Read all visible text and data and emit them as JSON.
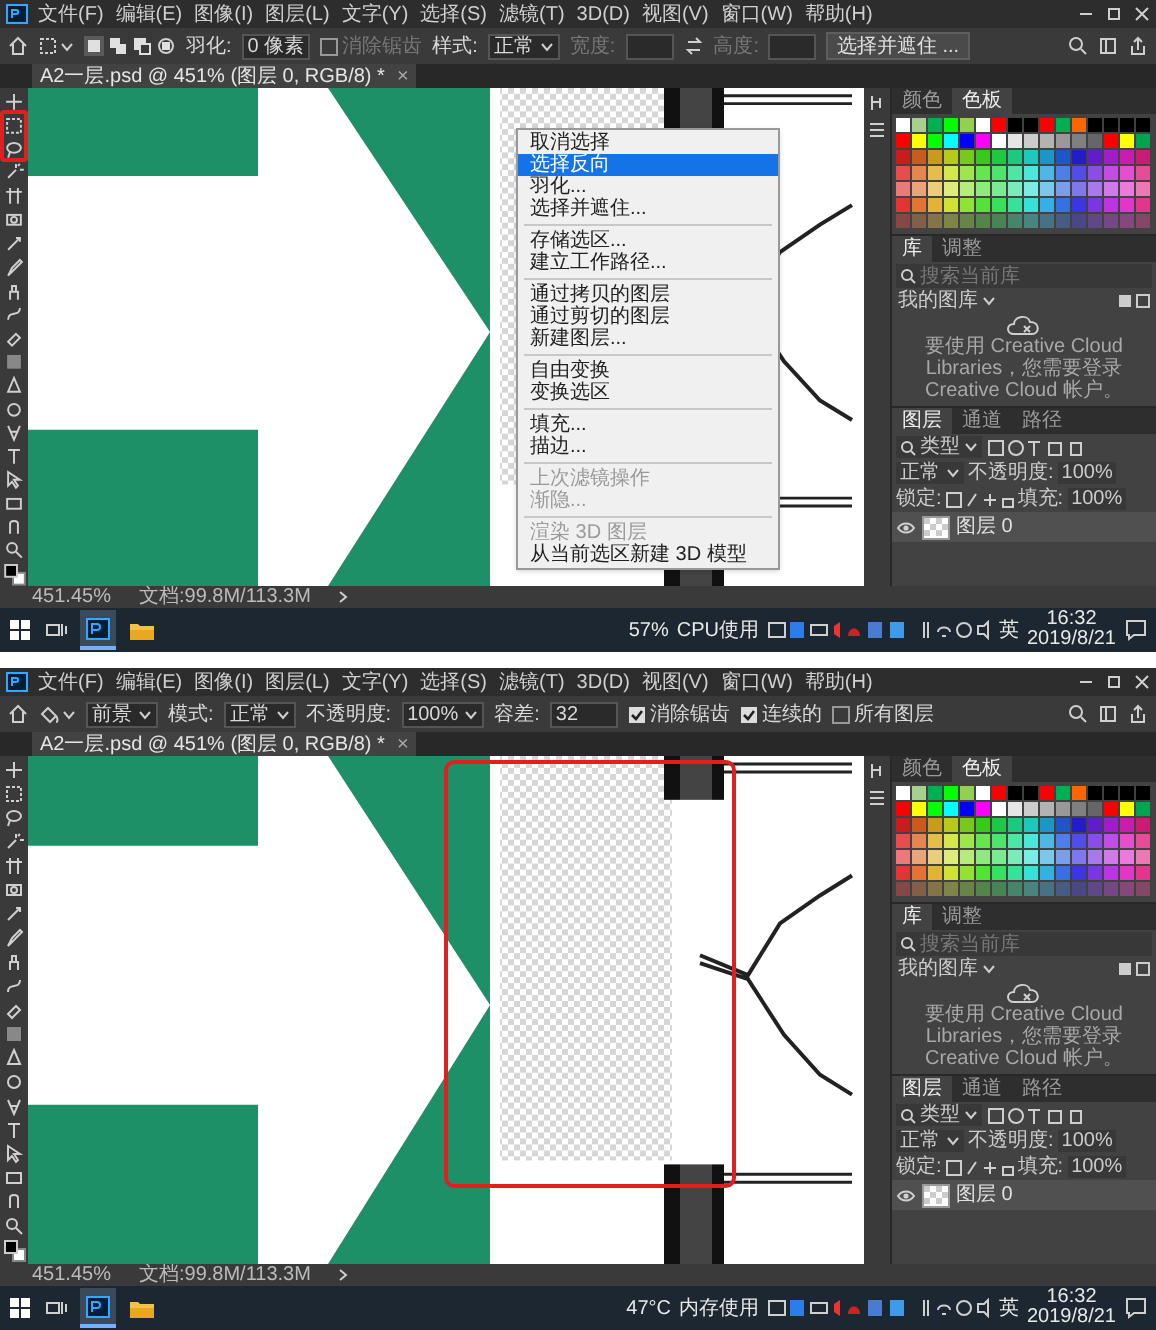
{
  "screenshots": [
    {
      "toolbar_highlighted": true,
      "canvas_highlighted": false,
      "menu_bar": [
        "文件(F)",
        "编辑(E)",
        "图像(I)",
        "图层(L)",
        "文字(Y)",
        "选择(S)",
        "滤镜(T)",
        "3D(D)",
        "视图(V)",
        "窗口(W)",
        "帮助(H)"
      ],
      "options_bar": [
        {
          "kind": "marquee_tool"
        },
        {
          "kind": "selection_modes"
        },
        {
          "kind": "label",
          "text": "羽化:",
          "disabled": false
        },
        {
          "kind": "field",
          "value": "0 像素"
        },
        {
          "kind": "checkbox",
          "text": "消除锯齿",
          "checked": false,
          "disabled": true
        },
        {
          "kind": "label",
          "text": "样式:",
          "disabled": false
        },
        {
          "kind": "dropdown",
          "value": "正常"
        },
        {
          "kind": "label",
          "text": "宽度:",
          "disabled": true
        },
        {
          "kind": "field"
        },
        {
          "kind": "swap"
        },
        {
          "kind": "label",
          "text": "高度:",
          "disabled": true
        },
        {
          "kind": "field"
        },
        {
          "kind": "button",
          "text": "选择并遮住 ..."
        }
      ],
      "document_tab": {
        "title": "A2一层.psd @ 451% (图层 0, RGB/8) *",
        "close": "×"
      },
      "context_menu": [
        [
          {
            "text": "取消选择",
            "selected": false,
            "disabled": false
          },
          {
            "text": "选择反向",
            "selected": true,
            "disabled": false
          },
          {
            "text": "羽化...",
            "selected": false,
            "disabled": false
          },
          {
            "text": "选择并遮住...",
            "selected": false,
            "disabled": false
          }
        ],
        [
          {
            "text": "存储选区...",
            "selected": false,
            "disabled": false
          },
          {
            "text": "建立工作路径...",
            "selected": false,
            "disabled": false
          }
        ],
        [
          {
            "text": "通过拷贝的图层",
            "selected": false,
            "disabled": false
          },
          {
            "text": "通过剪切的图层",
            "selected": false,
            "disabled": false
          },
          {
            "text": "新建图层...",
            "selected": false,
            "disabled": false
          }
        ],
        [
          {
            "text": "自由变换",
            "selected": false,
            "disabled": false
          },
          {
            "text": "变换选区",
            "selected": false,
            "disabled": false
          }
        ],
        [
          {
            "text": "填充...",
            "selected": false,
            "disabled": false
          },
          {
            "text": "描边...",
            "selected": false,
            "disabled": false
          }
        ],
        [
          {
            "text": "上次滤镜操作",
            "selected": false,
            "disabled": true
          },
          {
            "text": "渐隐...",
            "selected": false,
            "disabled": true
          }
        ],
        [
          {
            "text": "渲染 3D 图层",
            "selected": false,
            "disabled": true
          },
          {
            "text": "从当前选区新建 3D 模型",
            "selected": false,
            "disabled": false
          }
        ]
      ],
      "panels": {
        "swatch_tabs": [
          {
            "label": "颜色",
            "selected": false
          },
          {
            "label": "色板",
            "selected": true
          }
        ],
        "library_tabs": [
          {
            "label": "库",
            "selected": true
          },
          {
            "label": "调整",
            "selected": false
          }
        ],
        "library_search_placeholder": "搜索当前库",
        "library_name": "我的图库",
        "library_message": "要使用 Creative Cloud Libraries，您需要登录 Creative Cloud 帐户。",
        "layer_tabs": [
          {
            "label": "图层",
            "selected": true
          },
          {
            "label": "通道",
            "selected": false
          },
          {
            "label": "路径",
            "selected": false
          }
        ],
        "layer_filter": "类型",
        "blend_mode": "正常",
        "opacity_label": "不透明度:",
        "opacity": "100%",
        "lock_label": "锁定:",
        "fill_label": "填充:",
        "fill": "100%",
        "layers": [
          {
            "name": "图层 0",
            "visible": true
          }
        ]
      },
      "status_bar": {
        "zoom": "451.45%",
        "document": "文档:99.8M/113.3M"
      },
      "taskbar": {
        "meter_value": "57%",
        "meter_label": "CPU使用",
        "ime": "英",
        "time": "16:32",
        "date": "2019/8/21"
      }
    },
    {
      "toolbar_highlighted": false,
      "canvas_highlighted": true,
      "menu_bar": [
        "文件(F)",
        "编辑(E)",
        "图像(I)",
        "图层(L)",
        "文字(Y)",
        "选择(S)",
        "滤镜(T)",
        "3D(D)",
        "视图(V)",
        "窗口(W)",
        "帮助(H)"
      ],
      "options_bar": [
        {
          "kind": "bucket_tool"
        },
        {
          "kind": "dropdown",
          "value": "前景"
        },
        {
          "kind": "label",
          "text": "模式:",
          "disabled": false
        },
        {
          "kind": "dropdown",
          "value": "正常"
        },
        {
          "kind": "label",
          "text": "不透明度:",
          "disabled": false
        },
        {
          "kind": "dropdown",
          "value": "100%"
        },
        {
          "kind": "label",
          "text": "容差:",
          "disabled": false
        },
        {
          "kind": "field",
          "value": "32"
        },
        {
          "kind": "checkbox",
          "text": "消除锯齿",
          "checked": true,
          "disabled": false
        },
        {
          "kind": "checkbox",
          "text": "连续的",
          "checked": true,
          "disabled": false
        },
        {
          "kind": "checkbox",
          "text": "所有图层",
          "checked": false,
          "disabled": false
        }
      ],
      "document_tab": {
        "title": "A2一层.psd @ 451% (图层 0, RGB/8) *",
        "close": "×"
      },
      "panels": {
        "swatch_tabs": [
          {
            "label": "颜色",
            "selected": false
          },
          {
            "label": "色板",
            "selected": true
          }
        ],
        "library_tabs": [
          {
            "label": "库",
            "selected": true
          },
          {
            "label": "调整",
            "selected": false
          }
        ],
        "library_search_placeholder": "搜索当前库",
        "library_name": "我的图库",
        "library_message": "要使用 Creative Cloud Libraries，您需要登录 Creative Cloud 帐户。",
        "layer_tabs": [
          {
            "label": "图层",
            "selected": true
          },
          {
            "label": "通道",
            "selected": false
          },
          {
            "label": "路径",
            "selected": false
          }
        ],
        "layer_filter": "类型",
        "blend_mode": "正常",
        "opacity_label": "不透明度:",
        "opacity": "100%",
        "lock_label": "锁定:",
        "fill_label": "填充:",
        "fill": "100%",
        "layers": [
          {
            "name": "图层 0",
            "visible": true
          }
        ]
      },
      "status_bar": {
        "zoom": "451.45%",
        "document": "文档:99.8M/113.3M"
      },
      "taskbar": {
        "meter_value": "47°C",
        "meter_label": "内存使用",
        "ime": "英",
        "time": "16:32",
        "date": "2019/8/21"
      }
    }
  ]
}
